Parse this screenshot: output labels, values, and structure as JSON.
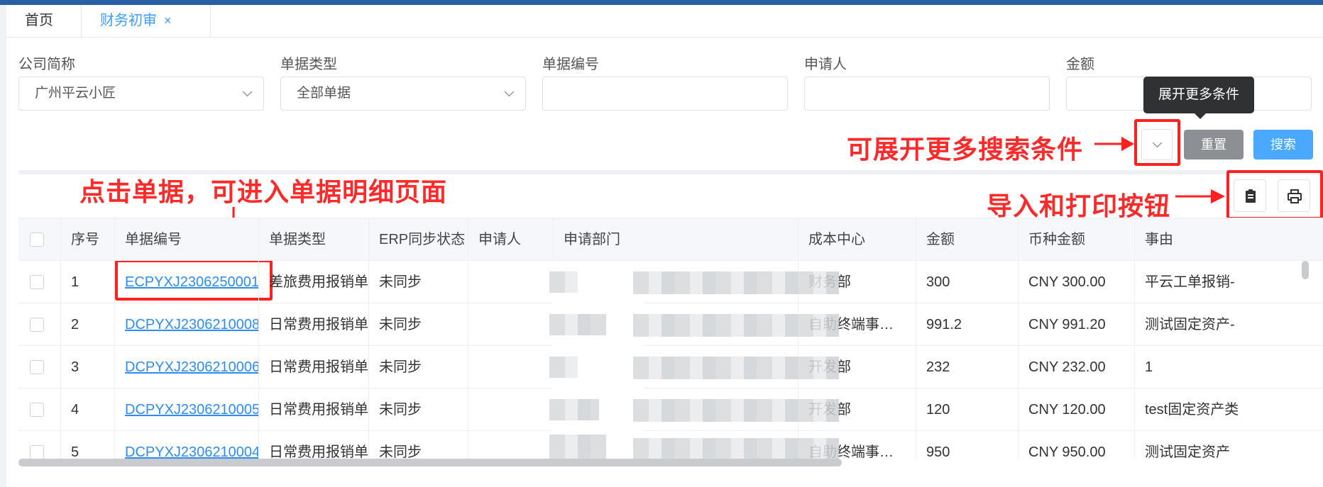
{
  "tabs": [
    {
      "label": "首页"
    },
    {
      "label": "财务初审",
      "close": "×"
    }
  ],
  "filters": {
    "company": {
      "label": "公司简称",
      "value": "广州平云小匠"
    },
    "doc_type": {
      "label": "单据类型",
      "value": "全部单据"
    },
    "doc_no": {
      "label": "单据编号",
      "value": ""
    },
    "applicant": {
      "label": "申请人",
      "value": ""
    },
    "amount": {
      "label": "金额",
      "value": ""
    }
  },
  "tooltip": "展开更多条件",
  "buttons": {
    "reset": "重置",
    "search": "搜索"
  },
  "annotations": {
    "expand": "可展开更多搜索条件",
    "click_doc": "点击单据，可进入单据明细页面",
    "import_print": "导入和打印按钮"
  },
  "table": {
    "headers": [
      "序号",
      "单据编号",
      "单据类型",
      "ERP同步状态",
      "申请人",
      "申请部门",
      "成本中心",
      "金额",
      "币种金额",
      "事由"
    ],
    "rows": [
      {
        "index": "1",
        "doc_no": "ECPYXJ2306250001",
        "type": "差旅费用报销单",
        "erp": "未同步",
        "applicant": "",
        "dept": "",
        "cost_center": "财务部",
        "amount": "300",
        "currency_amount": "CNY 300.00",
        "reason": "平云工单报销-"
      },
      {
        "index": "2",
        "doc_no": "DCPYXJ2306210008",
        "type": "日常费用报销单",
        "erp": "未同步",
        "applicant": "",
        "dept": "",
        "cost_center": "自助终端事…",
        "amount": "991.2",
        "currency_amount": "CNY 991.20",
        "reason": "测试固定资产-"
      },
      {
        "index": "3",
        "doc_no": "DCPYXJ2306210006",
        "type": "日常费用报销单",
        "erp": "未同步",
        "applicant": "",
        "dept": "",
        "cost_center": "开发部",
        "amount": "232",
        "currency_amount": "CNY 232.00",
        "reason": "1"
      },
      {
        "index": "4",
        "doc_no": "DCPYXJ2306210005",
        "type": "日常费用报销单",
        "erp": "未同步",
        "applicant": "",
        "dept": "",
        "cost_center": "开发部",
        "amount": "120",
        "currency_amount": "CNY 120.00",
        "reason": "test固定资产类"
      },
      {
        "index": "5",
        "doc_no": "DCPYXJ2306210004",
        "type": "日常费用报销单",
        "erp": "未同步",
        "applicant": "",
        "dept": "",
        "cost_center": "自助终端事…",
        "amount": "950",
        "currency_amount": "CNY 950.00",
        "reason": "测试固定资产"
      }
    ]
  },
  "icons": {
    "import": "clipboard-icon",
    "print": "printer-icon",
    "expand": "chevron-down-icon",
    "select": "chevron-down-icon"
  },
  "colors": {
    "accent": "#409eff",
    "link": "#2f8cf0",
    "annotation": "#ff2020",
    "reset_button": "#8c8f94",
    "search_button": "#4aa8ff"
  }
}
